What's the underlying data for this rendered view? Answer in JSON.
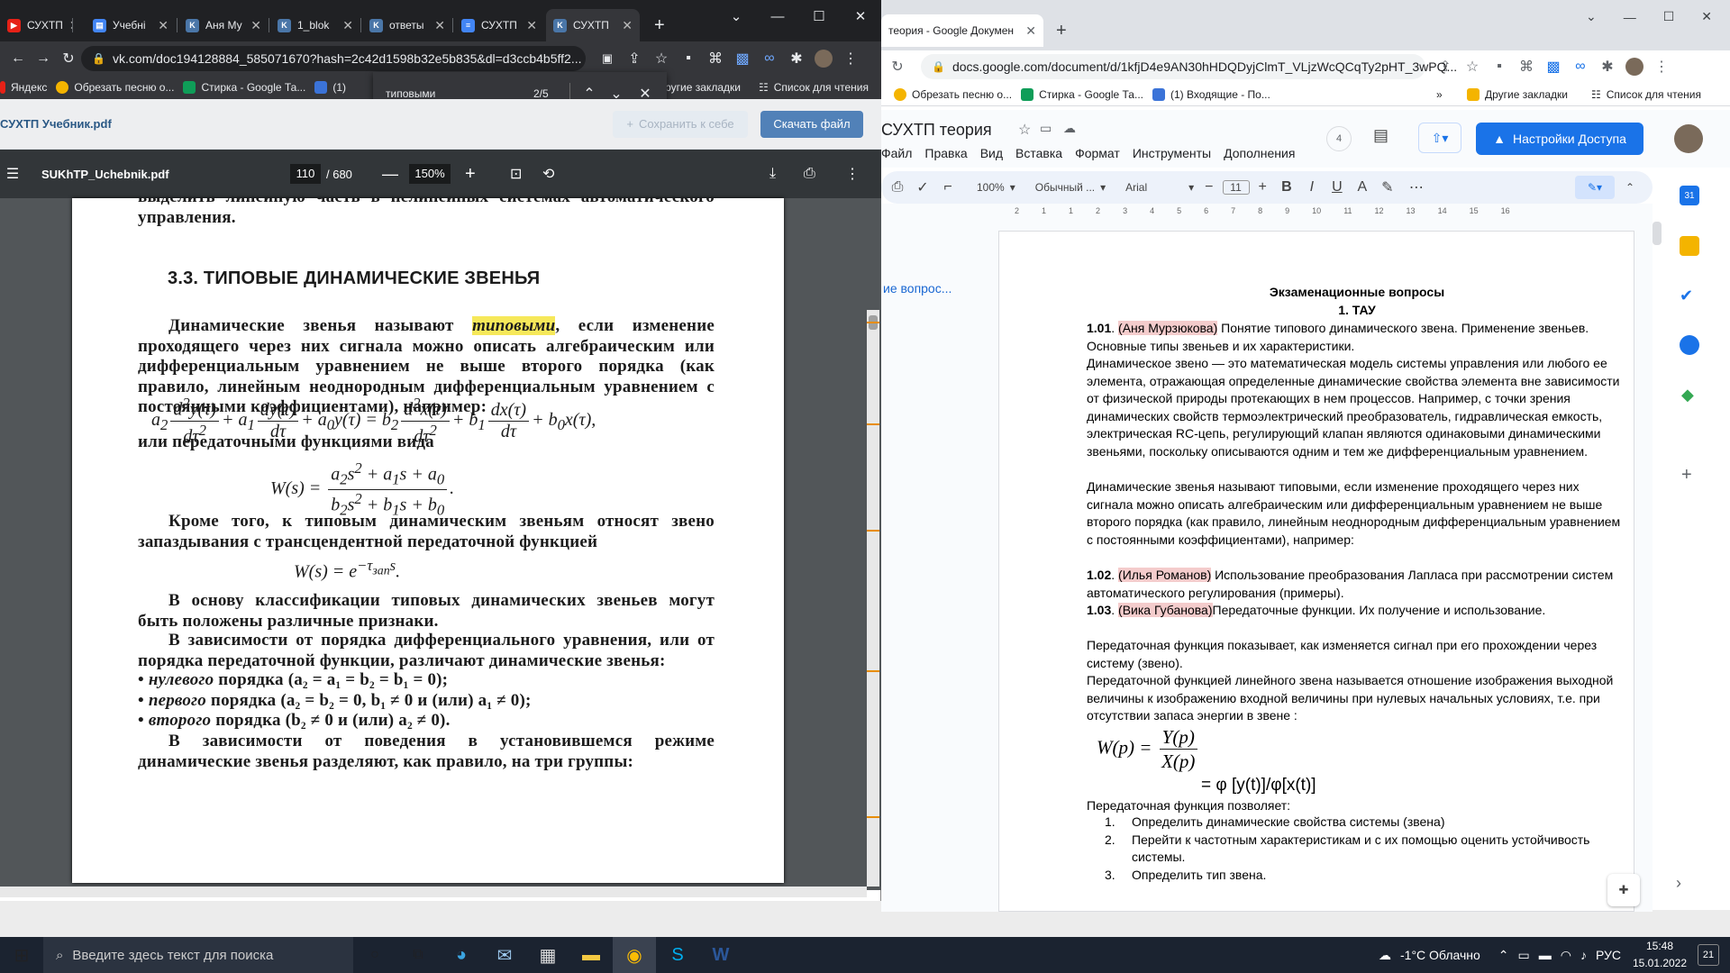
{
  "left_browser": {
    "tabs": [
      {
        "label": "СУХТП",
        "icon": "youtube-icon"
      },
      {
        "label": "Учебні",
        "icon": "document-icon"
      },
      {
        "label": "Аня Му",
        "icon": "vk-icon"
      },
      {
        "label": "1_blok",
        "icon": "vk-icon"
      },
      {
        "label": "ответы",
        "icon": "vk-icon"
      },
      {
        "label": "СУХТП",
        "icon": "google-docs-icon"
      },
      {
        "label": "СУХТП",
        "icon": "vk-icon"
      }
    ],
    "new_tab": "+",
    "url": "vk.com/doc194128884_585071670?hash=2c42d1598b32e5b835&dl=d3ccb4b5ff2...",
    "bookmarks": [
      "Яндекс",
      "Обрезать песню о...",
      "Стирка - Google Та...",
      "(1)"
    ],
    "bookmarks_right": [
      "Другие закладки",
      "Список для чтения"
    ],
    "find": {
      "query": "типовыми",
      "count": "2/5"
    },
    "vk_header": {
      "title": "СУХТП Учебник.pdf",
      "save": "Сохранить к себе",
      "download": "Скачать файл"
    },
    "pdf": {
      "filename": "SUKhTP_Uchebnik.pdf",
      "page": "110",
      "total": "/ 680",
      "zoom": "150%",
      "top_fragment": "выделить линейную часть в нелинейных системах автоматического управления.",
      "heading": "3.3. ТИПОВЫЕ ДИНАМИЧЕСКИЕ ЗВЕНЬЯ",
      "p1_a": "Динамические звенья называют ",
      "p1_em": "типовыми",
      "p1_b": ", если изменение проходящего через них сигнала можно описать алгебраическим или дифференциальным уравнением не выше второго порядка (как правило, линейным неоднородным дифференциальным уравнением с постоянными коэффициентами), например:",
      "or_text": "или передаточными функциями вида",
      "p2": "Кроме того, к типовым динамическим звеньям относят звено запаздывания с трансцендентной передаточной функцией",
      "p3": "В основу классификации типовых динамических звеньев могут быть положены различные признаки.",
      "p4": "В зависимости от порядка дифференциального уравнения, или от порядка передаточной функции, различают динамические звенья:",
      "bullets": [
        {
          "em": "нулевого",
          "text": " порядка (a₂ = a₁ = b₂ = b₁ = 0);"
        },
        {
          "em": "первого",
          "text": " порядка (a₂ = b₂ = 0, b₁ ≠ 0 и (или) a₁ ≠ 0);"
        },
        {
          "em": "второго",
          "text": " порядка (b₂ ≠ 0 и (или) a₂ ≠ 0)."
        }
      ],
      "p5": "В зависимости от поведения в установившемся режиме динамические звенья разделяют, как правило, на три группы:"
    }
  },
  "right_browser": {
    "tabs": [
      {
        "label": "теория - Google Докумен",
        "icon": "google-docs-icon"
      }
    ],
    "new_tab": "+",
    "url": "docs.google.com/document/d/1kfjD4e9AN30hHDQDyjClmT_VLjzWcQCqTy2pHT_3wPQ...",
    "bookmarks": [
      "Обрезать песню о...",
      "Стирка - Google Та...",
      "(1) Входящие - По..."
    ],
    "bookmarks_right": [
      "Другие закладки",
      "Список для чтения"
    ],
    "doc_title": "СУХТП теория",
    "menu": [
      "Файл",
      "Правка",
      "Вид",
      "Вставка",
      "Формат",
      "Инструменты",
      "Дополнения"
    ],
    "viewers": "4",
    "share": "Настройки Доступа",
    "toolbar": {
      "zoom": "100%",
      "style": "Обычный ...",
      "font": "Arial",
      "size": "11"
    },
    "ruler": [
      "2",
      "1",
      "1",
      "2",
      "3",
      "4",
      "5",
      "6",
      "7",
      "8",
      "9",
      "10",
      "11",
      "12",
      "13",
      "14",
      "15",
      "16"
    ],
    "outline_item": "ие вопрос...",
    "doc": {
      "title": "Экзаменационные вопросы",
      "subtitle": "1. ТАУ",
      "q1_num": "1.01",
      "q1_name": "(Аня Мурзюкова)",
      "q1_text": " Понятие типового динамического звена. Применение звеньев. Основные типы звеньев и их характеристики.",
      "para1": "Динамическое звено — это математическая модель системы управления или любого ее элемента, отражающая определенные динамические свойства элемента вне зависимости от физической природы протекающих в нем процессов. Например, с точки зрения динамических свойств термоэлектрический преобразователь, гидравлическая емкость, электрическая RC-цепь, регулирующий клапан являются одинаковыми динамическими звеньями, поскольку описываются одним и тем же дифференциальным уравнением.",
      "para2": "Динамические звенья называют типовыми, если изменение проходящего через них сигнала можно описать алгебраическим или дифференциальным уравнением не выше второго порядка (как правило, линейным неоднородным дифференциальным уравнением с постоянными коэффициентами), например:",
      "q2_num": "1.02",
      "q2_name": "(Илья Романов)",
      "q2_text": " Использование преобразования Лапласа при рассмотрении систем автоматического регулирования (примеры).",
      "q3_num": "1.03",
      "q3_name": "(Вика Губанова)",
      "q3_text": "Передаточные функции. Их получение и использование.",
      "para3": "Передаточная функция показывает, как изменяется сигнал при его прохождении через систему (звено).",
      "para4": "Передаточной функцией линейного звена называется отношение изображения выходной величины к изображению входной величины при нулевых начальных условиях, т.е. при отсутствии запаса энергии в звене :",
      "formula_right": "= φ [y(t)]/φ[x(t)]",
      "para5": "Передаточная функция позволяет:",
      "list": [
        {
          "n": "1.",
          "t": "Определить динамические свойства системы (звена)"
        },
        {
          "n": "2.",
          "t": "Перейти к частотным характеристикам и с их помощью оценить устойчивость системы."
        },
        {
          "n": "3.",
          "t": "Определить тип звена."
        }
      ]
    }
  },
  "taskbar": {
    "search_placeholder": "Введите здесь текст для поиска",
    "weather": "-1°C  Облачно",
    "lang": "РУС",
    "time": "15:48",
    "date": "15.01.2022",
    "notif": "21"
  }
}
